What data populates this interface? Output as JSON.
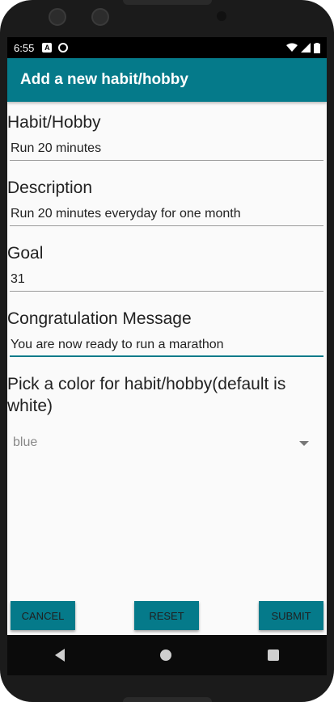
{
  "status_bar": {
    "time": "6:55"
  },
  "app_bar": {
    "title": "Add a new habit/hobby"
  },
  "form": {
    "habit": {
      "label": "Habit/Hobby",
      "value": "Run 20 minutes"
    },
    "description": {
      "label": "Description",
      "value": "Run 20 minutes everyday for one month"
    },
    "goal": {
      "label": "Goal",
      "value": "31"
    },
    "message": {
      "label": "Congratulation Message",
      "value": "You are now ready to run a marathon"
    },
    "color": {
      "label": "Pick a color for habit/hobby(default is white)",
      "value": "blue"
    }
  },
  "buttons": {
    "cancel": "CANCEL",
    "reset": "RESET",
    "submit": "SUBMIT"
  },
  "colors": {
    "accent": "#057a8a",
    "status_bar": "#000000",
    "background": "#fafafa"
  }
}
